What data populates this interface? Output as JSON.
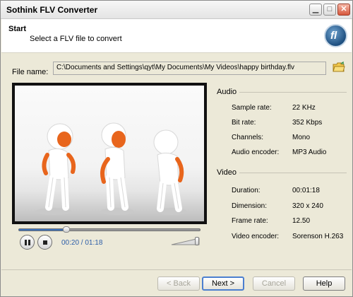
{
  "window": {
    "title": "Sothink FLV Converter"
  },
  "header": {
    "title": "Start",
    "subtitle": "Select a FLV file to convert"
  },
  "file": {
    "label": "File name:",
    "path": "C:\\Documents and Settings\\qyt\\My Documents\\My Videos\\happy birthday.flv"
  },
  "player": {
    "time": "00:20 / 01:18",
    "progress_fraction": 0.26,
    "volume_fraction": 0.9
  },
  "audio": {
    "heading": "Audio",
    "rows": [
      {
        "label": "Sample rate:",
        "value": "22 KHz"
      },
      {
        "label": "Bit rate:",
        "value": "352 Kbps"
      },
      {
        "label": "Channels:",
        "value": "Mono"
      },
      {
        "label": "Audio encoder:",
        "value": "MP3 Audio"
      }
    ]
  },
  "video": {
    "heading": "Video",
    "rows": [
      {
        "label": "Duration:",
        "value": "00:01:18"
      },
      {
        "label": "Dimension:",
        "value": "320 x 240"
      },
      {
        "label": "Frame rate:",
        "value": "12.50"
      },
      {
        "label": "Video encoder:",
        "value": "Sorenson H.263"
      }
    ]
  },
  "buttons": {
    "back": "< Back",
    "next": "Next >",
    "cancel": "Cancel",
    "help": "Help"
  },
  "colors": {
    "figure_accent": "#e8651c",
    "time_text": "#2c5da8"
  }
}
